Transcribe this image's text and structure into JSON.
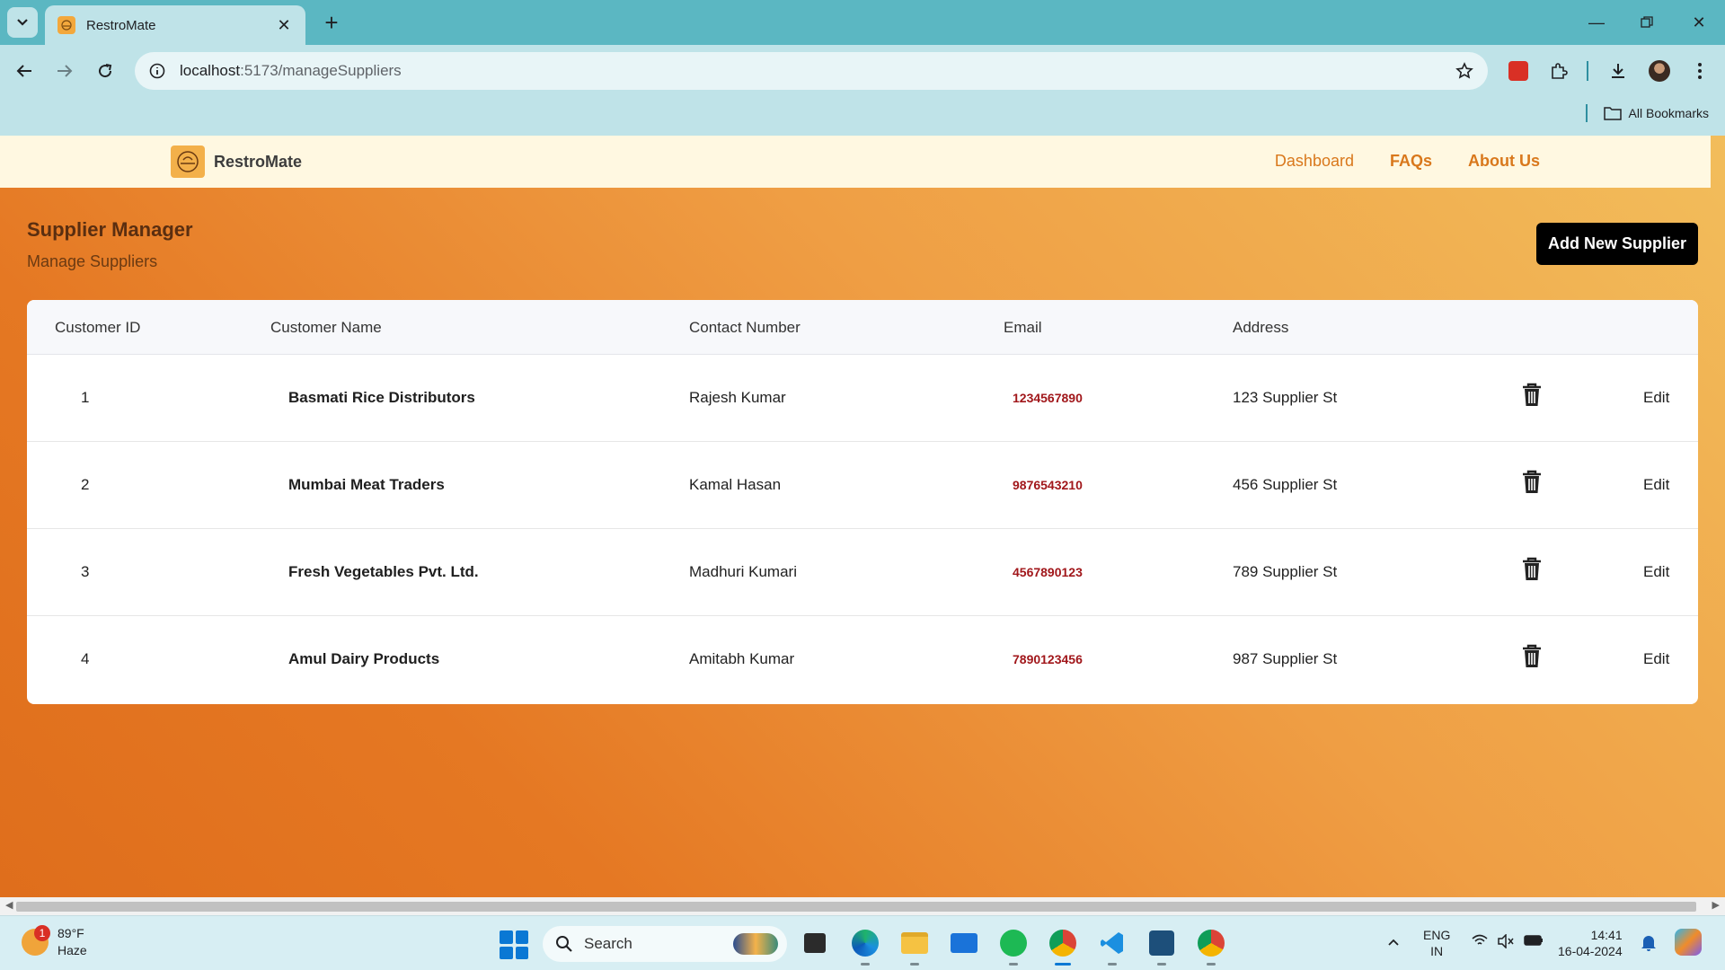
{
  "browser": {
    "tab_title": "RestroMate",
    "url_host": "localhost",
    "url_path": ":5173/manageSuppliers",
    "bookmarks_label": "All Bookmarks"
  },
  "header": {
    "brand": "RestroMate",
    "nav": [
      "Dashboard",
      "FAQs",
      "About Us"
    ]
  },
  "page": {
    "title": "Supplier Manager",
    "subtitle": "Manage Suppliers",
    "add_button": "Add New Supplier"
  },
  "table": {
    "columns": [
      "Customer ID",
      "Customer Name",
      "Contact Number",
      "Email",
      "Address"
    ],
    "edit_label": "Edit",
    "rows": [
      {
        "id": "1",
        "name": "Basmati Rice Distributors",
        "contact": "Rajesh Kumar",
        "phone": "1234567890",
        "address": "123 Supplier St"
      },
      {
        "id": "2",
        "name": "Mumbai Meat Traders",
        "contact": "Kamal Hasan",
        "phone": "9876543210",
        "address": "456 Supplier St"
      },
      {
        "id": "3",
        "name": "Fresh Vegetables Pvt. Ltd.",
        "contact": "Madhuri Kumari",
        "phone": "4567890123",
        "address": "789 Supplier St"
      },
      {
        "id": "4",
        "name": "Amul Dairy Products",
        "contact": "Amitabh Kumar",
        "phone": "7890123456",
        "address": "987 Supplier St"
      }
    ]
  },
  "taskbar": {
    "weather_temp": "89°F",
    "weather_cond": "Haze",
    "weather_badge": "1",
    "search_placeholder": "Search",
    "lang_top": "ENG",
    "lang_bottom": "IN",
    "time": "14:41",
    "date": "16-04-2024"
  },
  "colors": {
    "accent": "#d9781c",
    "phone": "#a1171b",
    "header_bg": "#fff8e1"
  }
}
